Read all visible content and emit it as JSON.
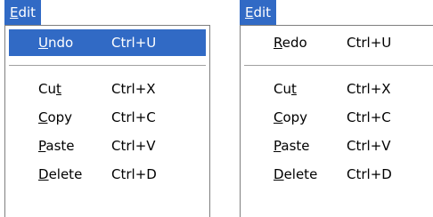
{
  "left_menu": {
    "title": {
      "mnemonic": "E",
      "rest": "dit"
    },
    "items": [
      {
        "pre": "",
        "mnemonic": "U",
        "post": "ndo",
        "shortcut": "Ctrl+U"
      },
      {
        "pre": "Cu",
        "mnemonic": "t",
        "post": "",
        "shortcut": "Ctrl+X"
      },
      {
        "pre": "",
        "mnemonic": "C",
        "post": "opy",
        "shortcut": "Ctrl+C"
      },
      {
        "pre": "",
        "mnemonic": "P",
        "post": "aste",
        "shortcut": "Ctrl+V"
      },
      {
        "pre": "",
        "mnemonic": "D",
        "post": "elete",
        "shortcut": "Ctrl+D"
      }
    ]
  },
  "right_menu": {
    "title": {
      "mnemonic": "E",
      "rest": "dit"
    },
    "items": [
      {
        "pre": "",
        "mnemonic": "R",
        "post": "edo",
        "shortcut": "Ctrl+U"
      },
      {
        "pre": "Cu",
        "mnemonic": "t",
        "post": "",
        "shortcut": "Ctrl+X"
      },
      {
        "pre": "",
        "mnemonic": "C",
        "post": "opy",
        "shortcut": "Ctrl+C"
      },
      {
        "pre": "",
        "mnemonic": "P",
        "post": "aste",
        "shortcut": "Ctrl+V"
      },
      {
        "pre": "",
        "mnemonic": "D",
        "post": "elete",
        "shortcut": "Ctrl+D"
      }
    ]
  },
  "colors": {
    "highlight": "#316ac5",
    "highlight_text": "#ffffff",
    "border": "#7f7f7f"
  }
}
